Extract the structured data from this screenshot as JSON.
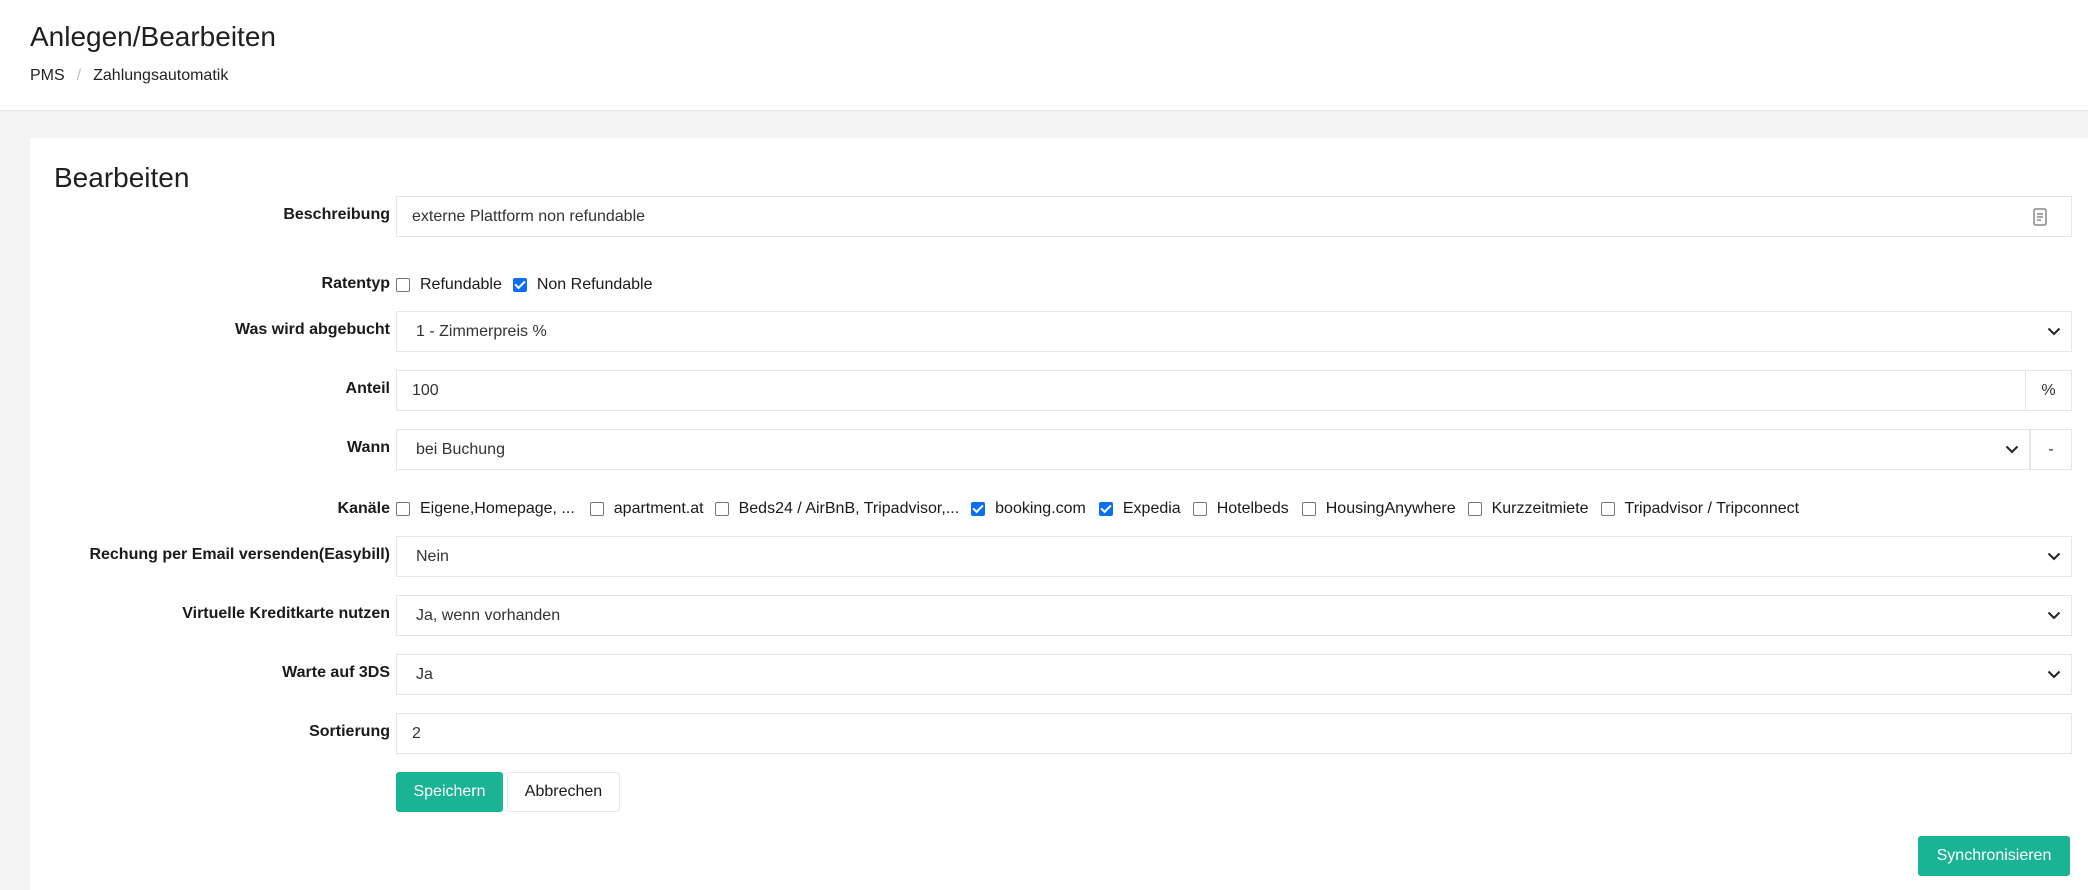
{
  "header": {
    "title": "Anlegen/Bearbeiten",
    "breadcrumb": [
      "PMS",
      "Zahlungsautomatik"
    ]
  },
  "form": {
    "title": "Bearbeiten",
    "beschreibung": {
      "label": "Beschreibung",
      "value": "externe Plattform non refundable"
    },
    "ratentyp": {
      "label": "Ratentyp",
      "options": [
        {
          "label": "Refundable",
          "checked": false
        },
        {
          "label": "Non Refundable",
          "checked": true
        }
      ]
    },
    "abgebucht": {
      "label": "Was wird abgebucht",
      "value": "1 - Zimmerpreis %"
    },
    "anteil": {
      "label": "Anteil",
      "value": "100",
      "addon": "%"
    },
    "wann": {
      "label": "Wann",
      "value": "bei Buchung",
      "addon": "-"
    },
    "kanaele": {
      "label": "Kanäle",
      "options": [
        {
          "label": "Eigene,Homepage, ...",
          "checked": false
        },
        {
          "label": "apartment.at",
          "checked": false
        },
        {
          "label": "Beds24 / AirBnB, Tripadvisor,...",
          "checked": false
        },
        {
          "label": "booking.com",
          "checked": true
        },
        {
          "label": "Expedia",
          "checked": true
        },
        {
          "label": "Hotelbeds",
          "checked": false
        },
        {
          "label": "HousingAnywhere",
          "checked": false
        },
        {
          "label": "Kurzzeitmiete",
          "checked": false
        },
        {
          "label": "Tripadvisor / Tripconnect",
          "checked": false
        }
      ]
    },
    "rechnung": {
      "label": "Rechung per Email versenden(Easybill)",
      "value": "Nein"
    },
    "kreditkarte": {
      "label": "Virtuelle Kreditkarte nutzen",
      "value": "Ja, wenn vorhanden"
    },
    "dreids": {
      "label": "Warte auf 3DS",
      "value": "Ja"
    },
    "sortierung": {
      "label": "Sortierung",
      "value": "2"
    },
    "buttons": {
      "save": "Speichern",
      "cancel": "Abbrechen",
      "sync": "Synchronisieren"
    }
  },
  "colors": {
    "primary": "#1ab394",
    "checkbox": "#0b6ff5",
    "background": "#f3f3f4"
  }
}
